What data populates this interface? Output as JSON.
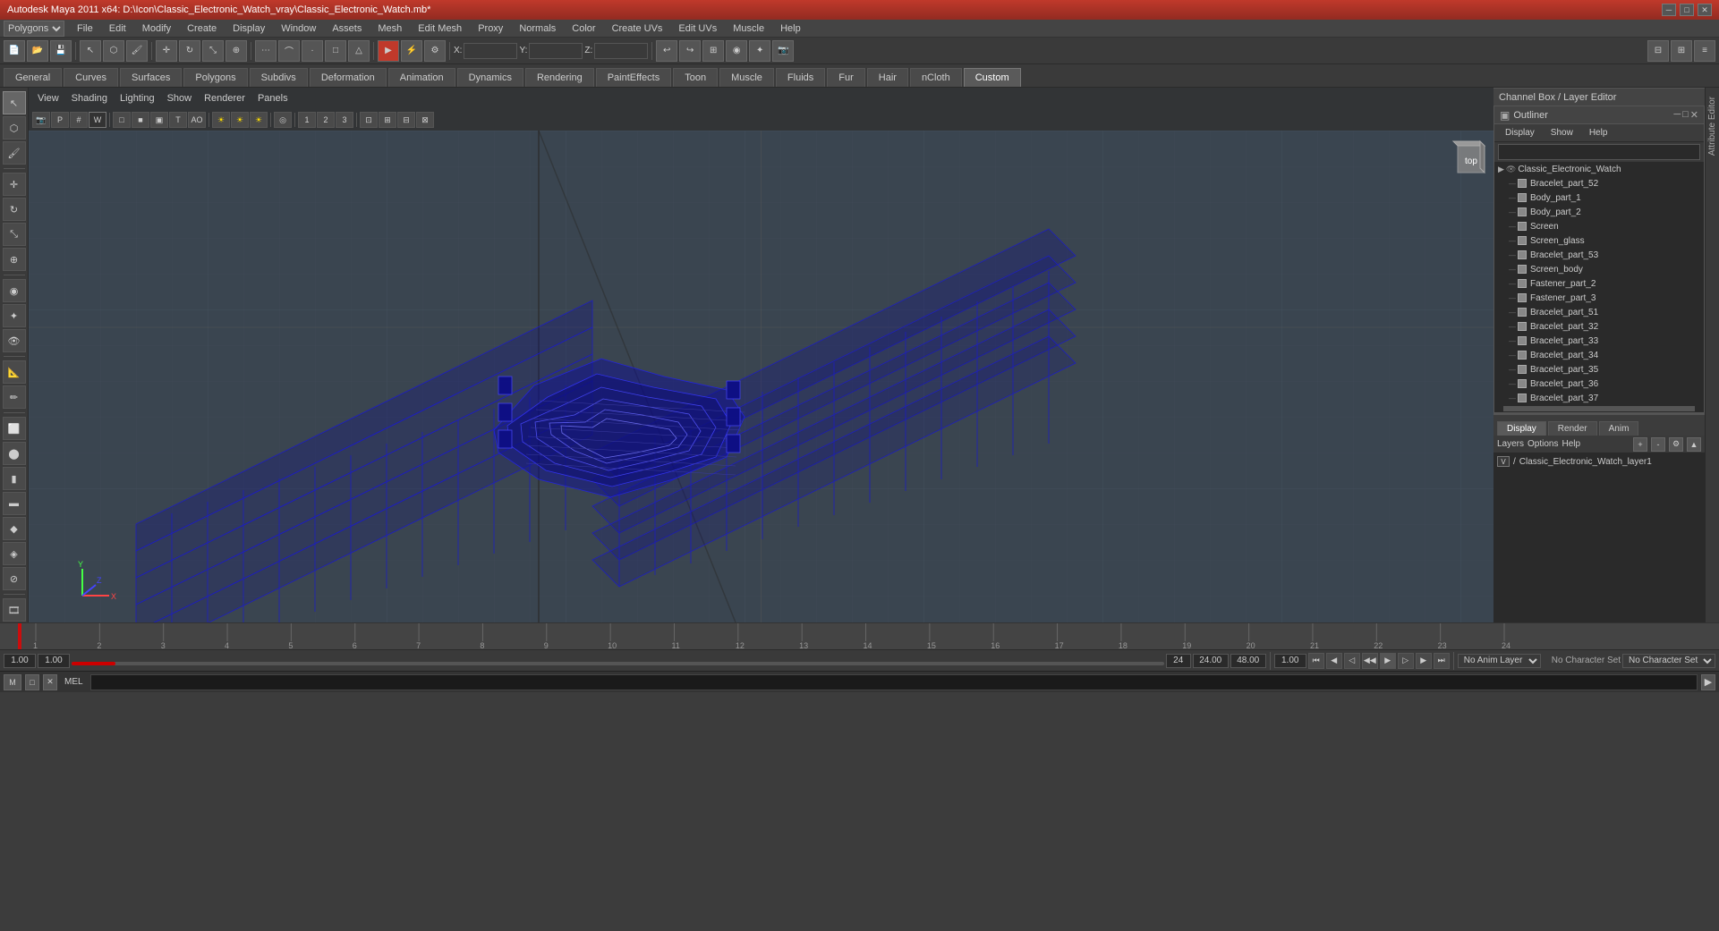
{
  "title_bar": {
    "title": "Autodesk Maya 2011 x64: D:\\Icon\\Classic_Electronic_Watch_vray\\Classic_Electronic_Watch.mb*",
    "minimize": "─",
    "maximize": "□",
    "close": "✕"
  },
  "menu_bar": {
    "items": [
      "File",
      "Edit",
      "Modify",
      "Create",
      "Display",
      "Window",
      "Assets",
      "Mesh",
      "Edit Mesh",
      "Proxy",
      "Normals",
      "Color",
      "Create UVs",
      "Edit UVs",
      "Muscle",
      "Help"
    ]
  },
  "polygon_dropdown": {
    "value": "Polygons"
  },
  "tabs": {
    "items": [
      "General",
      "Curves",
      "Surfaces",
      "Polygons",
      "Subdivs",
      "Deformation",
      "Animation",
      "Dynamics",
      "Rendering",
      "PaintEffects",
      "Toon",
      "Muscle",
      "Fluids",
      "Fur",
      "Hair",
      "nCloth",
      "Custom"
    ]
  },
  "viewport_menus": {
    "items": [
      "View",
      "Shading",
      "Lighting",
      "Show",
      "Renderer",
      "Panels"
    ]
  },
  "outliner": {
    "title": "Outliner",
    "menus": [
      "Display",
      "Show",
      "Help"
    ],
    "items": [
      {
        "name": "Classic_Electronic_Watch",
        "level": 0,
        "icon": "folder"
      },
      {
        "name": "Bracelet_part_52",
        "level": 1,
        "icon": "mesh"
      },
      {
        "name": "Body_part_1",
        "level": 1,
        "icon": "mesh"
      },
      {
        "name": "Body_part_2",
        "level": 1,
        "icon": "mesh"
      },
      {
        "name": "Screen",
        "level": 1,
        "icon": "mesh"
      },
      {
        "name": "Screen_glass",
        "level": 1,
        "icon": "mesh"
      },
      {
        "name": "Bracelet_part_53",
        "level": 1,
        "icon": "mesh"
      },
      {
        "name": "Screen_body",
        "level": 1,
        "icon": "mesh"
      },
      {
        "name": "Fastener_part_2",
        "level": 1,
        "icon": "mesh"
      },
      {
        "name": "Fastener_part_3",
        "level": 1,
        "icon": "mesh"
      },
      {
        "name": "Bracelet_part_51",
        "level": 1,
        "icon": "mesh"
      },
      {
        "name": "Bracelet_part_32",
        "level": 1,
        "icon": "mesh"
      },
      {
        "name": "Bracelet_part_33",
        "level": 1,
        "icon": "mesh"
      },
      {
        "name": "Bracelet_part_34",
        "level": 1,
        "icon": "mesh"
      },
      {
        "name": "Bracelet_part_35",
        "level": 1,
        "icon": "mesh"
      },
      {
        "name": "Bracelet_part_36",
        "level": 1,
        "icon": "mesh"
      },
      {
        "name": "Bracelet_part_37",
        "level": 1,
        "icon": "mesh"
      }
    ]
  },
  "channel_box_header": "Channel Box / Layer Editor",
  "layer_tabs": [
    "Display",
    "Render",
    "Anim"
  ],
  "layer_tab_active": "Display",
  "layers_menu": [
    "Layers",
    "Options",
    "Help"
  ],
  "layers": [
    {
      "name": "Classic_Electronic_Watch_layer1",
      "visible": "V"
    }
  ],
  "playback": {
    "current_frame": "1.00",
    "start": "1.00",
    "frame_marker": "1",
    "end_marker": "24",
    "end_time": "24.00",
    "max_time": "48.00",
    "anim_layer": "No Anim Layer",
    "character_set": "No Character Set",
    "speed": "1.00"
  },
  "timeline": {
    "ticks": [
      "1",
      "2",
      "3",
      "4",
      "5",
      "6",
      "7",
      "8",
      "9",
      "10",
      "11",
      "12",
      "13",
      "14",
      "15",
      "16",
      "17",
      "18",
      "19",
      "20",
      "21",
      "22",
      "23",
      "24"
    ]
  },
  "mel_label": "MEL",
  "mel_placeholder": "",
  "status_line": "",
  "toolbar_icons": {
    "file_new": "📄",
    "file_open": "📂",
    "file_save": "💾"
  }
}
